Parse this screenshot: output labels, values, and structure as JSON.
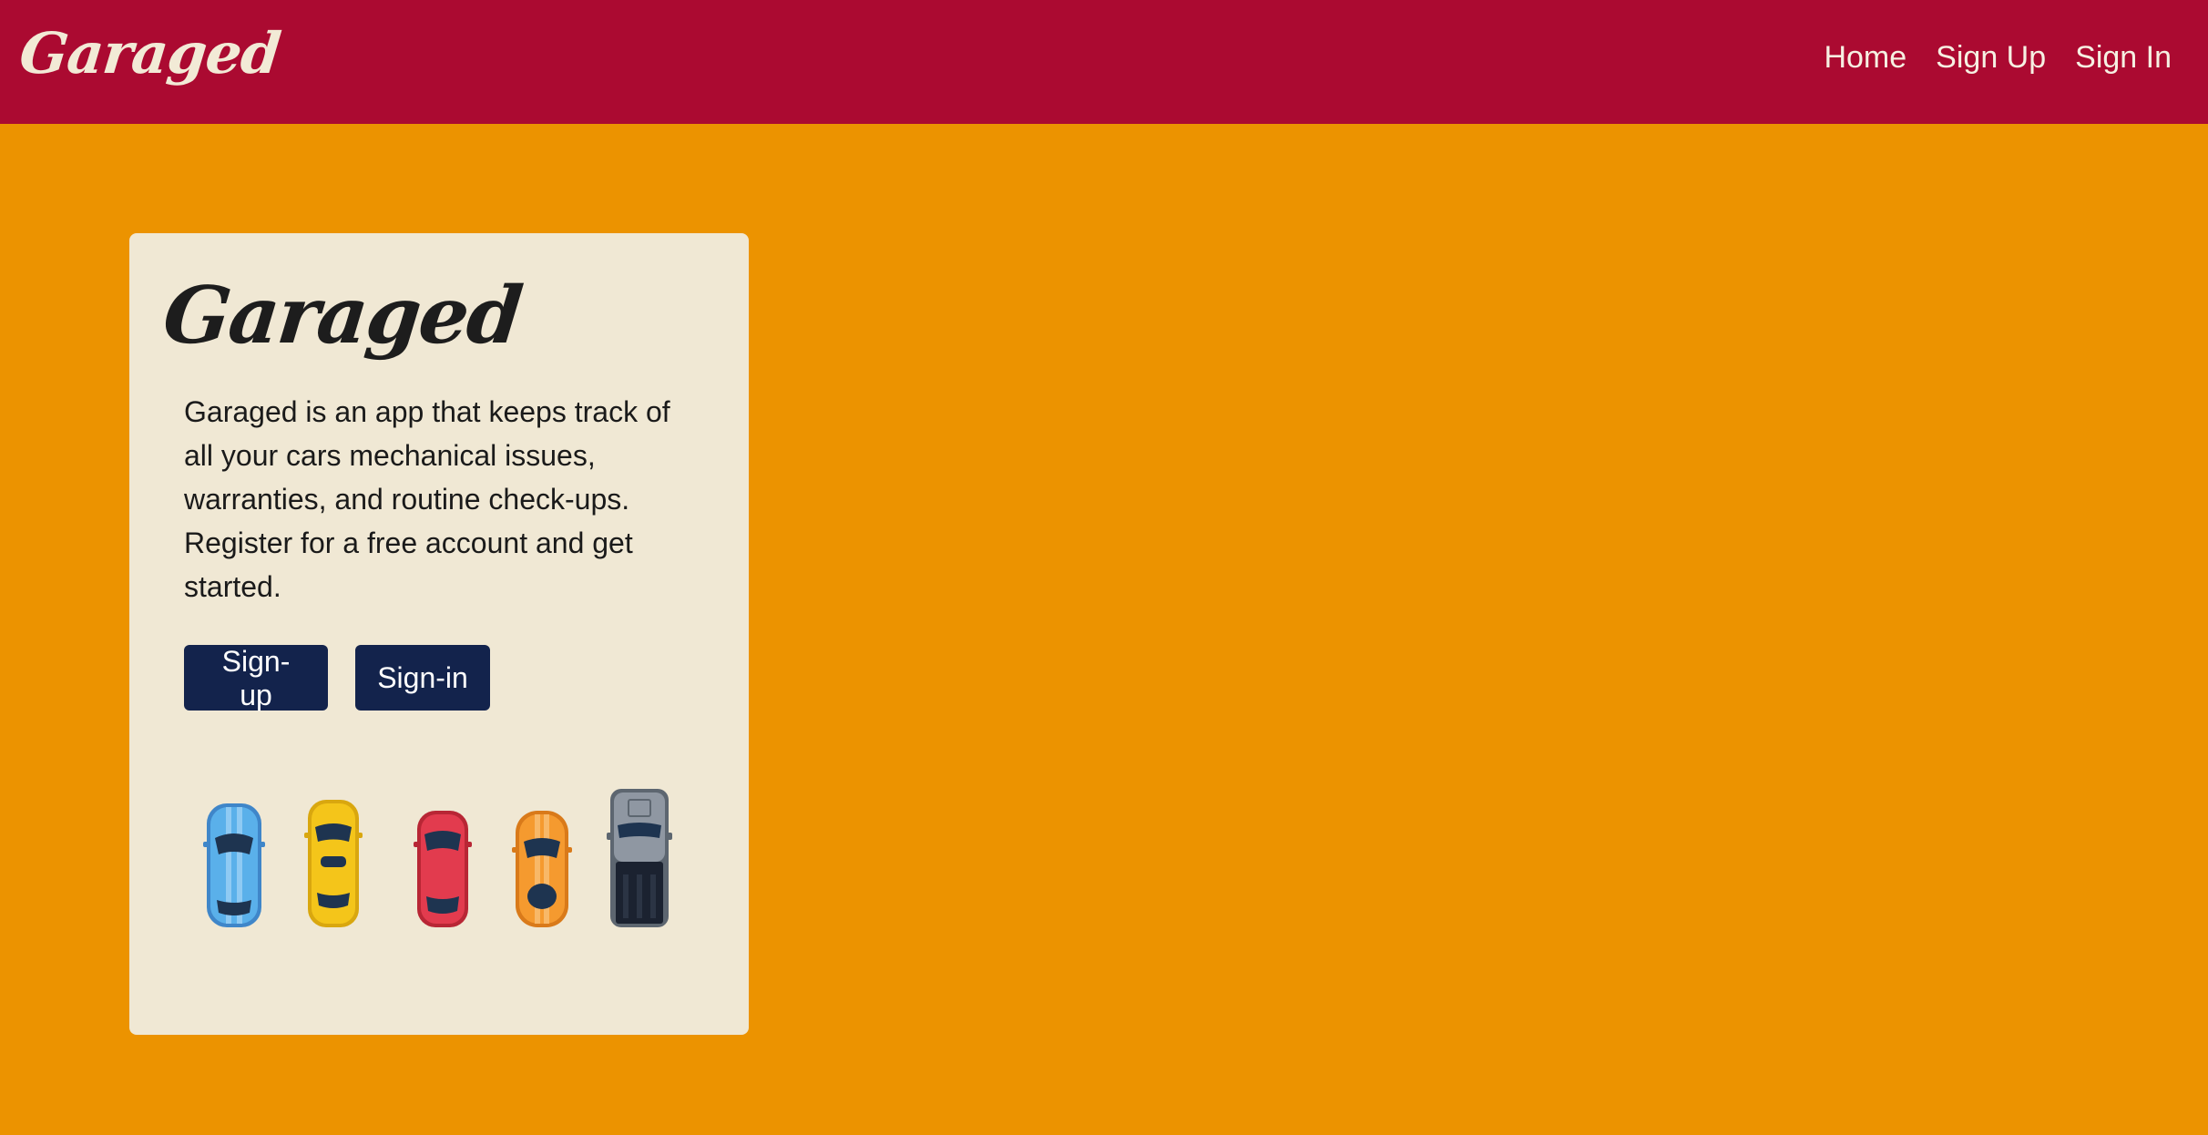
{
  "navbar": {
    "brand": "Garaged",
    "links": [
      {
        "label": "Home"
      },
      {
        "label": "Sign Up"
      },
      {
        "label": "Sign In"
      }
    ]
  },
  "hero": {
    "title": "Garaged",
    "description": "Garaged is an app that keeps track of all your cars mechanical issues, warranties, and routine check-ups. Register for a free account and get started.",
    "signup_label": "Sign-up",
    "signin_label": "Sign-in"
  },
  "colors": {
    "navbar": "#ab0a31",
    "background": "#ec9300",
    "card": "#f0e8d4",
    "button": "#13234c"
  },
  "cars": [
    {
      "name": "blue-sports-car-icon",
      "color": "#5ab0ea"
    },
    {
      "name": "yellow-taxi-icon",
      "color": "#f4c51a"
    },
    {
      "name": "red-car-icon",
      "color": "#e23b4e"
    },
    {
      "name": "orange-sports-car-icon",
      "color": "#f59a2f"
    },
    {
      "name": "gray-pickup-truck-icon",
      "color": "#8f97a2"
    }
  ]
}
